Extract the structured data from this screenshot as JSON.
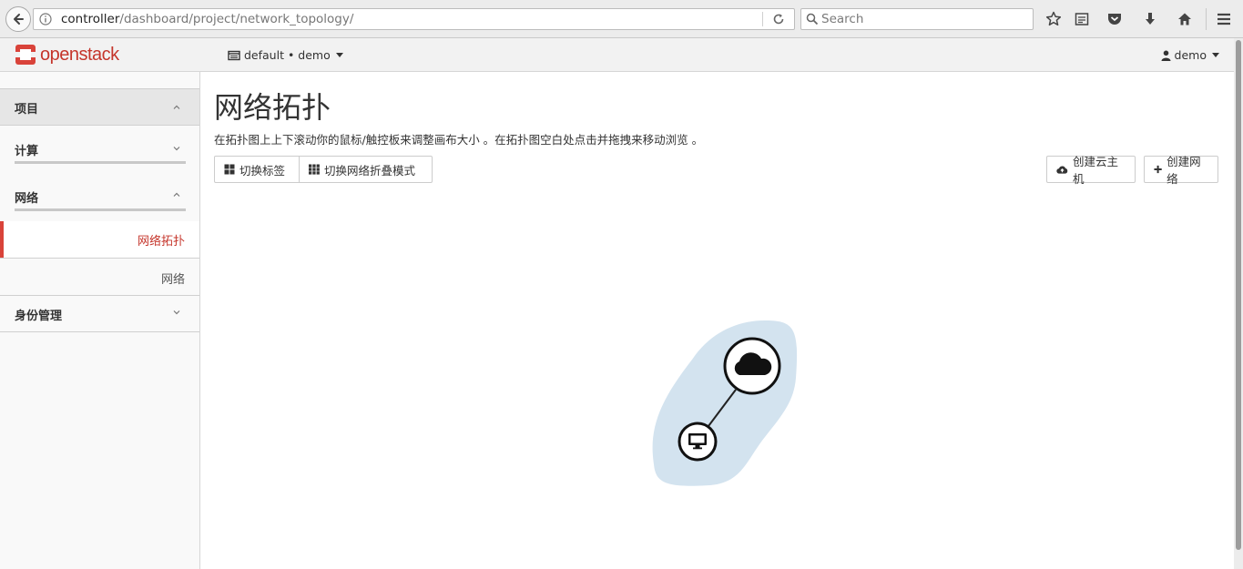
{
  "browser": {
    "url_host": "controller",
    "url_path": "/dashboard/project/network_topology/",
    "search_placeholder": "Search"
  },
  "header": {
    "logo_text": "openstack",
    "project_selector": "default • demo",
    "user_menu": "demo"
  },
  "sidebar": {
    "sections": [
      {
        "label": "项目",
        "expanded": true
      },
      {
        "label": "计算",
        "expanded": false
      },
      {
        "label": "网络",
        "expanded": true
      },
      {
        "label": "身份管理",
        "expanded": false
      }
    ],
    "network_items": [
      {
        "label": "网络拓扑",
        "active": true
      },
      {
        "label": "网络",
        "active": false
      }
    ]
  },
  "main": {
    "title": "网络拓扑",
    "help": "在拓扑图上上下滚动你的鼠标/触控板来调整画布大小 。在拓扑图空白处点击并拖拽来移动浏览 。",
    "buttons": {
      "toggle_labels": "切换标签",
      "toggle_collapse": "切换网络折叠模式",
      "create_instance": "创建云主机",
      "create_network": "创建网络"
    }
  },
  "topology": {
    "nodes": [
      {
        "type": "network",
        "icon": "cloud-icon"
      },
      {
        "type": "instance",
        "icon": "monitor-icon"
      }
    ],
    "links": [
      [
        "network",
        "instance"
      ]
    ]
  },
  "colors": {
    "brand_red": "#c5352b",
    "active_border": "#d9433a",
    "topology_blob": "#d3e3ef"
  }
}
